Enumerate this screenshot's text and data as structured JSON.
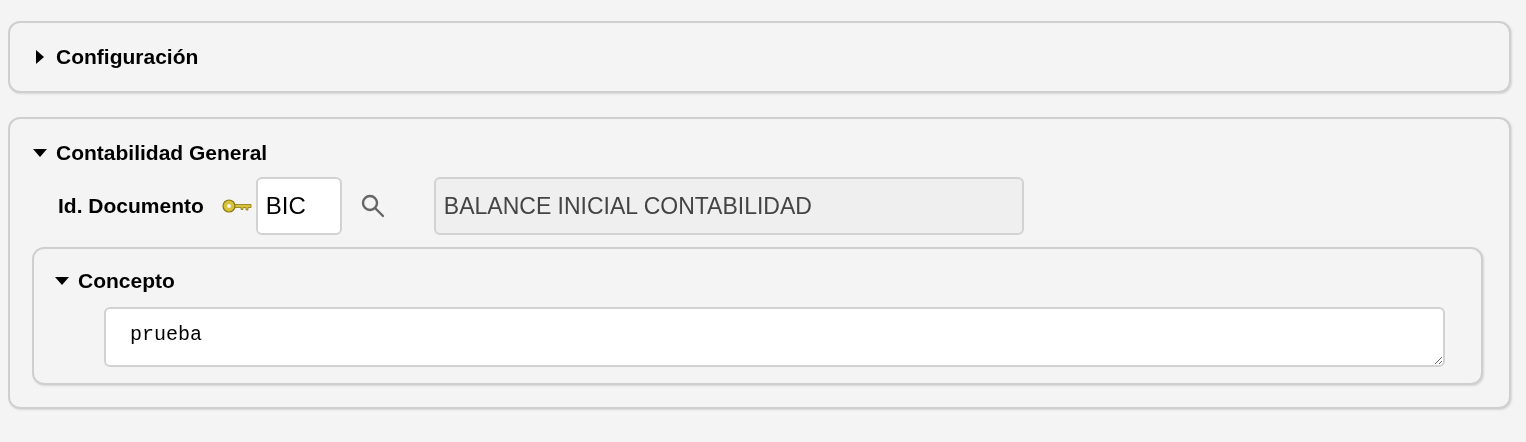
{
  "sections": [
    {
      "title": "Configuración",
      "expanded": false
    },
    {
      "title": "Contabilidad General",
      "expanded": true,
      "field": {
        "label": "Id. Documento",
        "value": "BIC",
        "description": "BALANCE INICIAL CONTABILIDAD"
      },
      "subsection": {
        "title": "Concepto",
        "expanded": true,
        "value": "prueba"
      }
    }
  ]
}
